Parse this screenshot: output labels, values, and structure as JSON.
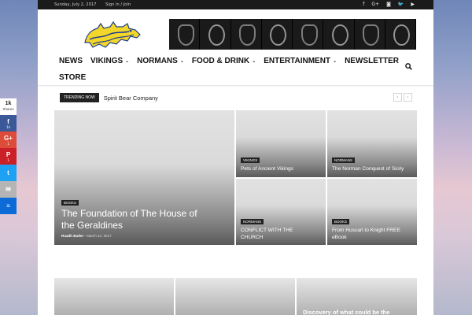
{
  "topbar": {
    "date": "Sunday, July 2, 2017",
    "signin": "Sign in / Join",
    "social_icons": [
      "facebook-icon",
      "google-plus-icon",
      "instagram-icon",
      "twitter-icon",
      "youtube-icon"
    ]
  },
  "nav": {
    "items": [
      {
        "label": "NEWS",
        "dropdown": false
      },
      {
        "label": "VIKINGS",
        "dropdown": true
      },
      {
        "label": "NORMANS",
        "dropdown": true
      },
      {
        "label": "FOOD & DRINK",
        "dropdown": true
      },
      {
        "label": "ENTERTAINMENT",
        "dropdown": true
      },
      {
        "label": "NEWSLETTER",
        "dropdown": false
      }
    ],
    "store": "STORE",
    "search_icon": "search-icon"
  },
  "trending": {
    "label": "TRENDING NOW",
    "text": "Spirit Bear Company",
    "prev": "‹",
    "next": "›"
  },
  "featured": {
    "big": {
      "category": "BOOKS",
      "title": "The Foundation of The House of the Geraldines",
      "author": "Ruadh Butler",
      "separator": "-",
      "date": "March 22, 2017"
    },
    "small": [
      {
        "category": "VIKINGS",
        "title": "Pets of Ancient Vikings"
      },
      {
        "category": "NORMANS",
        "title": "The Norman Conquest of Sicily"
      },
      {
        "category": "NORMANS",
        "title": "CONFLICT WITH THE CHURCH"
      },
      {
        "category": "BOOKS",
        "title": "From Huscarl to Knight FREE eBook"
      }
    ]
  },
  "bottom": {
    "third_title": "Discovery of what could be the"
  },
  "share": {
    "total": "1k",
    "total_label": "Shares",
    "buttons": [
      {
        "name": "facebook",
        "glyph": "f",
        "count": "1k",
        "color": "#3b5998"
      },
      {
        "name": "google-plus",
        "glyph": "G+",
        "count": "1",
        "color": "#dd4b39"
      },
      {
        "name": "pinterest",
        "glyph": "P",
        "count": "1",
        "color": "#cb2027"
      },
      {
        "name": "twitter",
        "glyph": "t",
        "count": "",
        "color": "#1da1f2"
      },
      {
        "name": "email",
        "glyph": "✉",
        "count": "",
        "color": "#b5b5b5"
      },
      {
        "name": "sumome",
        "glyph": "≡",
        "count": "",
        "color": "#0c6bd6"
      }
    ]
  },
  "colors": {
    "topbar": "#1b1b1b",
    "logo_yellow": "#f2d72a",
    "logo_blue": "#1f3c8f"
  }
}
